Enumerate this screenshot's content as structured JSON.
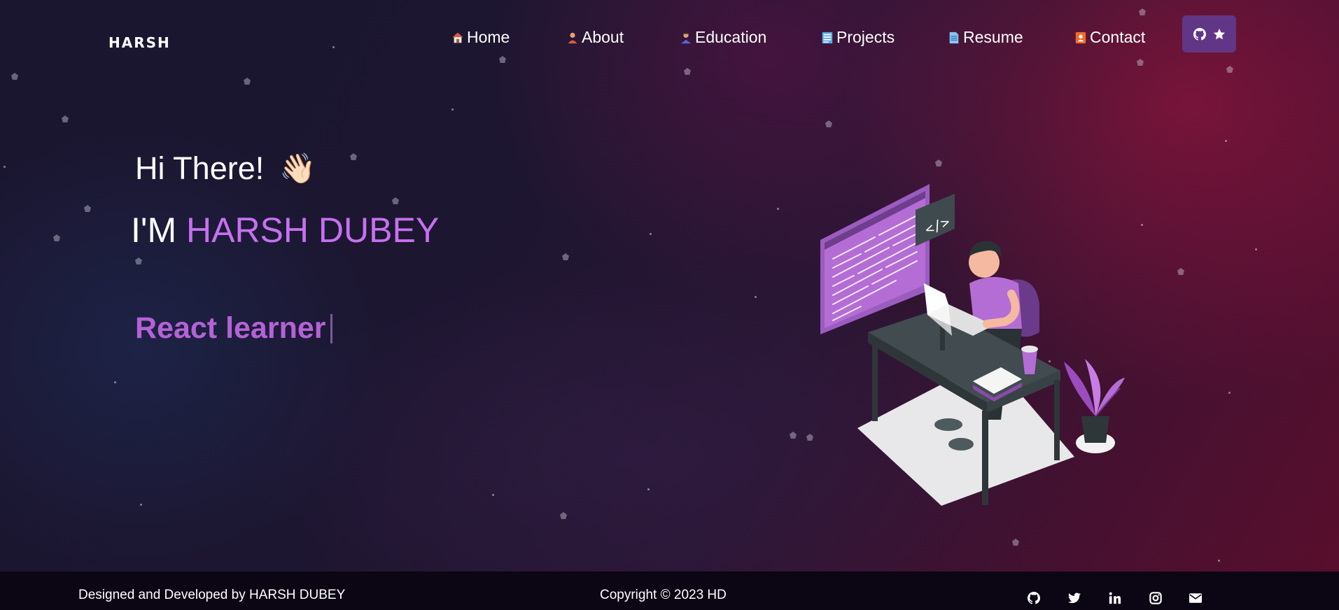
{
  "nav": {
    "brand": "HARSH",
    "items": [
      {
        "label": "Home",
        "icon": "home-icon"
      },
      {
        "label": "About",
        "icon": "user-icon"
      },
      {
        "label": "Education",
        "icon": "education-icon"
      },
      {
        "label": "Projects",
        "icon": "projects-icon"
      },
      {
        "label": "Resume",
        "icon": "document-icon"
      },
      {
        "label": "Contact",
        "icon": "contact-icon"
      }
    ],
    "github_button": {
      "icons": [
        "github-icon",
        "star-icon"
      ]
    }
  },
  "hero": {
    "greeting": "Hi There!",
    "greeting_emoji": "👋🏻",
    "name_prefix": "I'M ",
    "name": "HARSH DUBEY",
    "typed_text": "React learner"
  },
  "footer": {
    "designed_by": "Designed and Developed by HARSH DUBEY",
    "copyright": "Copyright © 2023 HD",
    "social_icons": [
      "github-icon",
      "twitter-icon",
      "linkedin-icon",
      "instagram-icon",
      "mail-icon"
    ]
  },
  "colors": {
    "accent": "#c770f0",
    "typed": "#b562d6",
    "button": "#623686",
    "footer_bg": "#0c0513"
  }
}
